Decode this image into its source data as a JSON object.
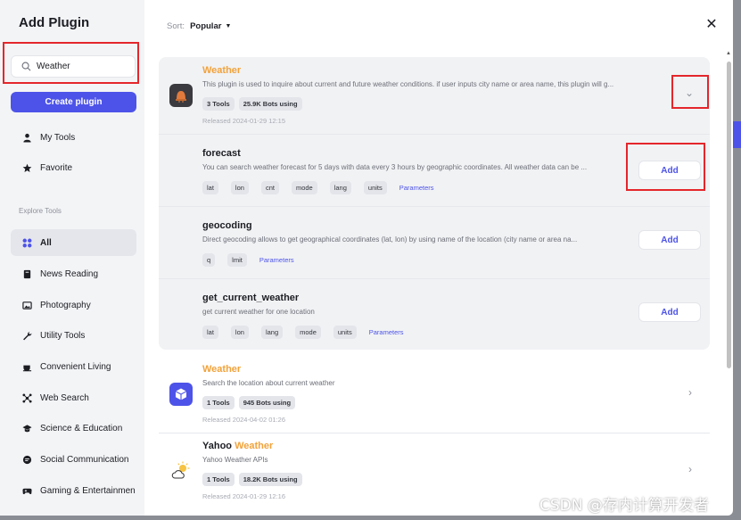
{
  "sidebar": {
    "title": "Add Plugin",
    "search_value": "Weather",
    "create_label": "Create plugin",
    "my_tools": "My Tools",
    "favorite": "Favorite",
    "explore_label": "Explore Tools",
    "categories": [
      "All",
      "News Reading",
      "Photography",
      "Utility Tools",
      "Convenient Living",
      "Web Search",
      "Science & Education",
      "Social Communication",
      "Gaming & Entertainmen"
    ]
  },
  "main": {
    "sort_label": "Sort:",
    "sort_value": "Popular",
    "plugins": [
      {
        "name": "Weather",
        "desc": "This plugin is used to inquire about current and future weather conditions. if user inputs city name or area name, this plugin will g...",
        "tools": "3 Tools",
        "bots": "25.9K Bots using",
        "date": "Released 2024-01-29 12:15",
        "tools_list": [
          {
            "name": "forecast",
            "desc": "You can search weather forecast for 5 days with data every 3 hours by geographic coordinates. All weather data can be ...",
            "params": [
              "lat",
              "lon",
              "cnt",
              "mode",
              "lang",
              "units"
            ],
            "params_link": "Parameters",
            "add": "Add"
          },
          {
            "name": "geocoding",
            "desc": "Direct geocoding allows to get geographical coordinates (lat, lon) by using name of the location (city name or area na...",
            "params": [
              "q",
              "lmit"
            ],
            "params_link": "Parameters",
            "add": "Add"
          },
          {
            "name": "get_current_weather",
            "desc": "get current weather for one location",
            "params": [
              "lat",
              "lon",
              "lang",
              "mode",
              "units"
            ],
            "params_link": "Parameters",
            "add": "Add"
          }
        ]
      },
      {
        "name": "Weather",
        "desc": "Search the location about current weather",
        "tools": "1 Tools",
        "bots": "945 Bots using",
        "date": "Released 2024-04-02 01:26"
      },
      {
        "name_prefix": "Yahoo ",
        "name": "Weather",
        "desc": "Yahoo Weather APIs",
        "tools": "1 Tools",
        "bots": "18.2K Bots using",
        "date": "Released 2024-01-29 12:16"
      }
    ]
  },
  "watermark": "CSDN @存内计算开发者",
  "colors": {
    "accent": "#4d53e8",
    "highlight": "#f2a23a",
    "annotation": "#e4262b"
  }
}
